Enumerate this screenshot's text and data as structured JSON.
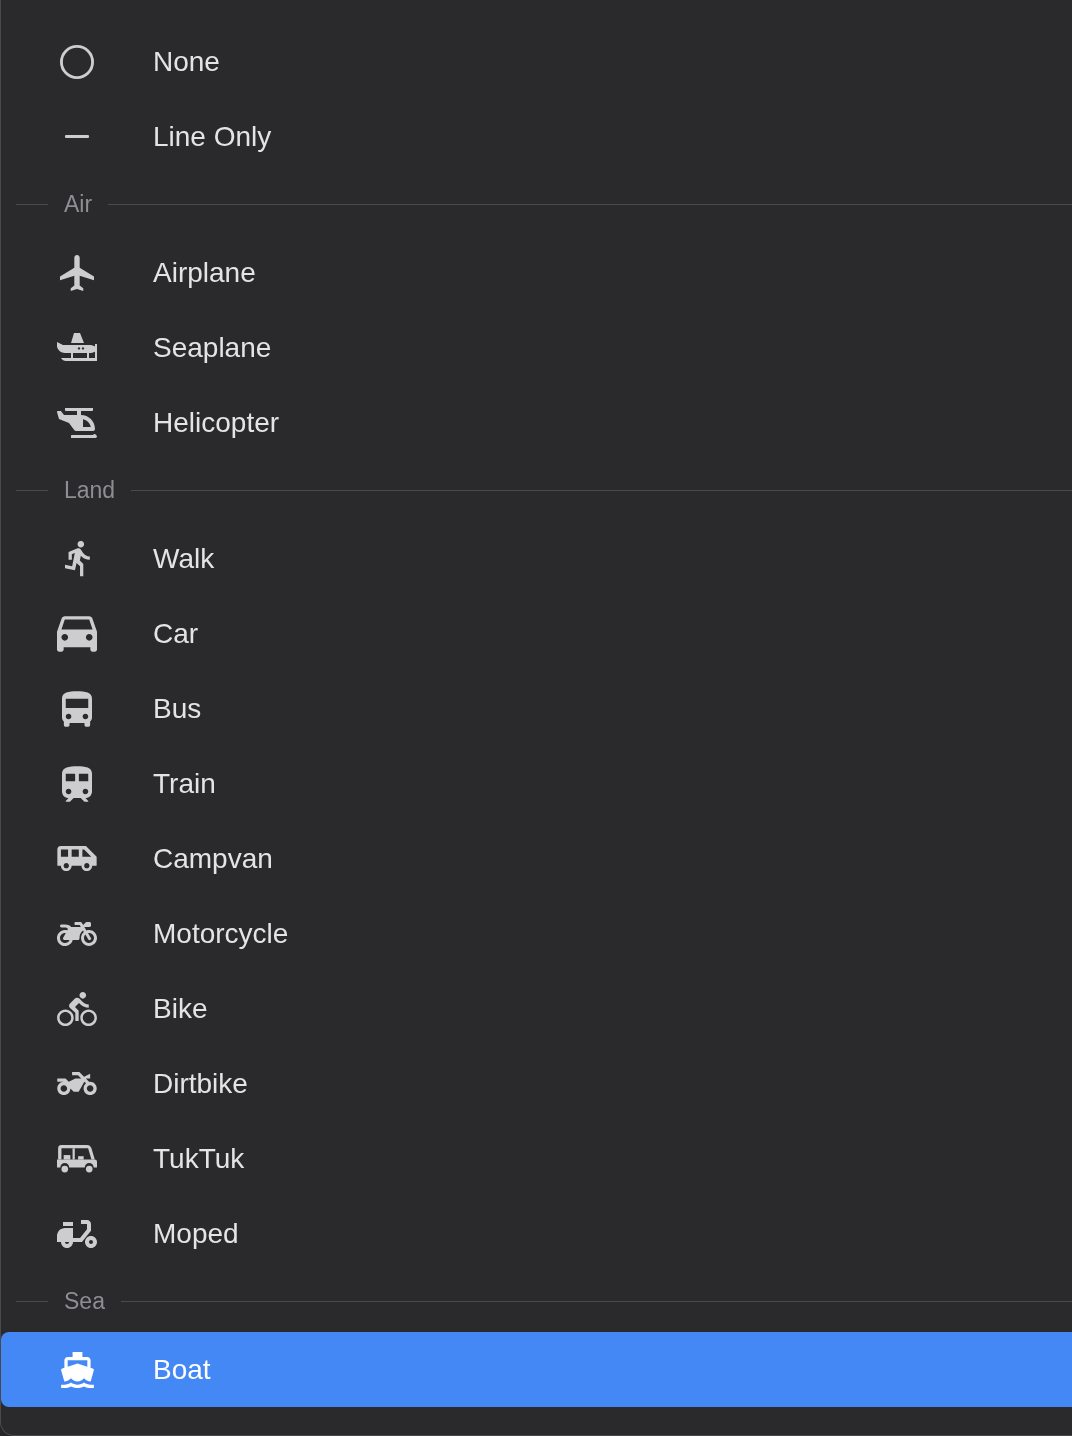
{
  "menu": {
    "items": [
      {
        "kind": "option",
        "label": "None",
        "selected": false
      },
      {
        "kind": "option",
        "label": "Line Only",
        "selected": false
      },
      {
        "kind": "section",
        "label": "Air"
      },
      {
        "kind": "option",
        "label": "Airplane",
        "selected": false
      },
      {
        "kind": "option",
        "label": "Seaplane",
        "selected": false
      },
      {
        "kind": "option",
        "label": "Helicopter",
        "selected": false
      },
      {
        "kind": "section",
        "label": "Land"
      },
      {
        "kind": "option",
        "label": "Walk",
        "selected": false
      },
      {
        "kind": "option",
        "label": "Car",
        "selected": false
      },
      {
        "kind": "option",
        "label": "Bus",
        "selected": false
      },
      {
        "kind": "option",
        "label": "Train",
        "selected": false
      },
      {
        "kind": "option",
        "label": "Campvan",
        "selected": false
      },
      {
        "kind": "option",
        "label": "Motorcycle",
        "selected": false
      },
      {
        "kind": "option",
        "label": "Bike",
        "selected": false
      },
      {
        "kind": "option",
        "label": "Dirtbike",
        "selected": false
      },
      {
        "kind": "option",
        "label": "TukTuk",
        "selected": false
      },
      {
        "kind": "option",
        "label": "Moped",
        "selected": false
      },
      {
        "kind": "section",
        "label": "Sea"
      },
      {
        "kind": "option",
        "label": "Boat",
        "selected": true
      }
    ]
  }
}
